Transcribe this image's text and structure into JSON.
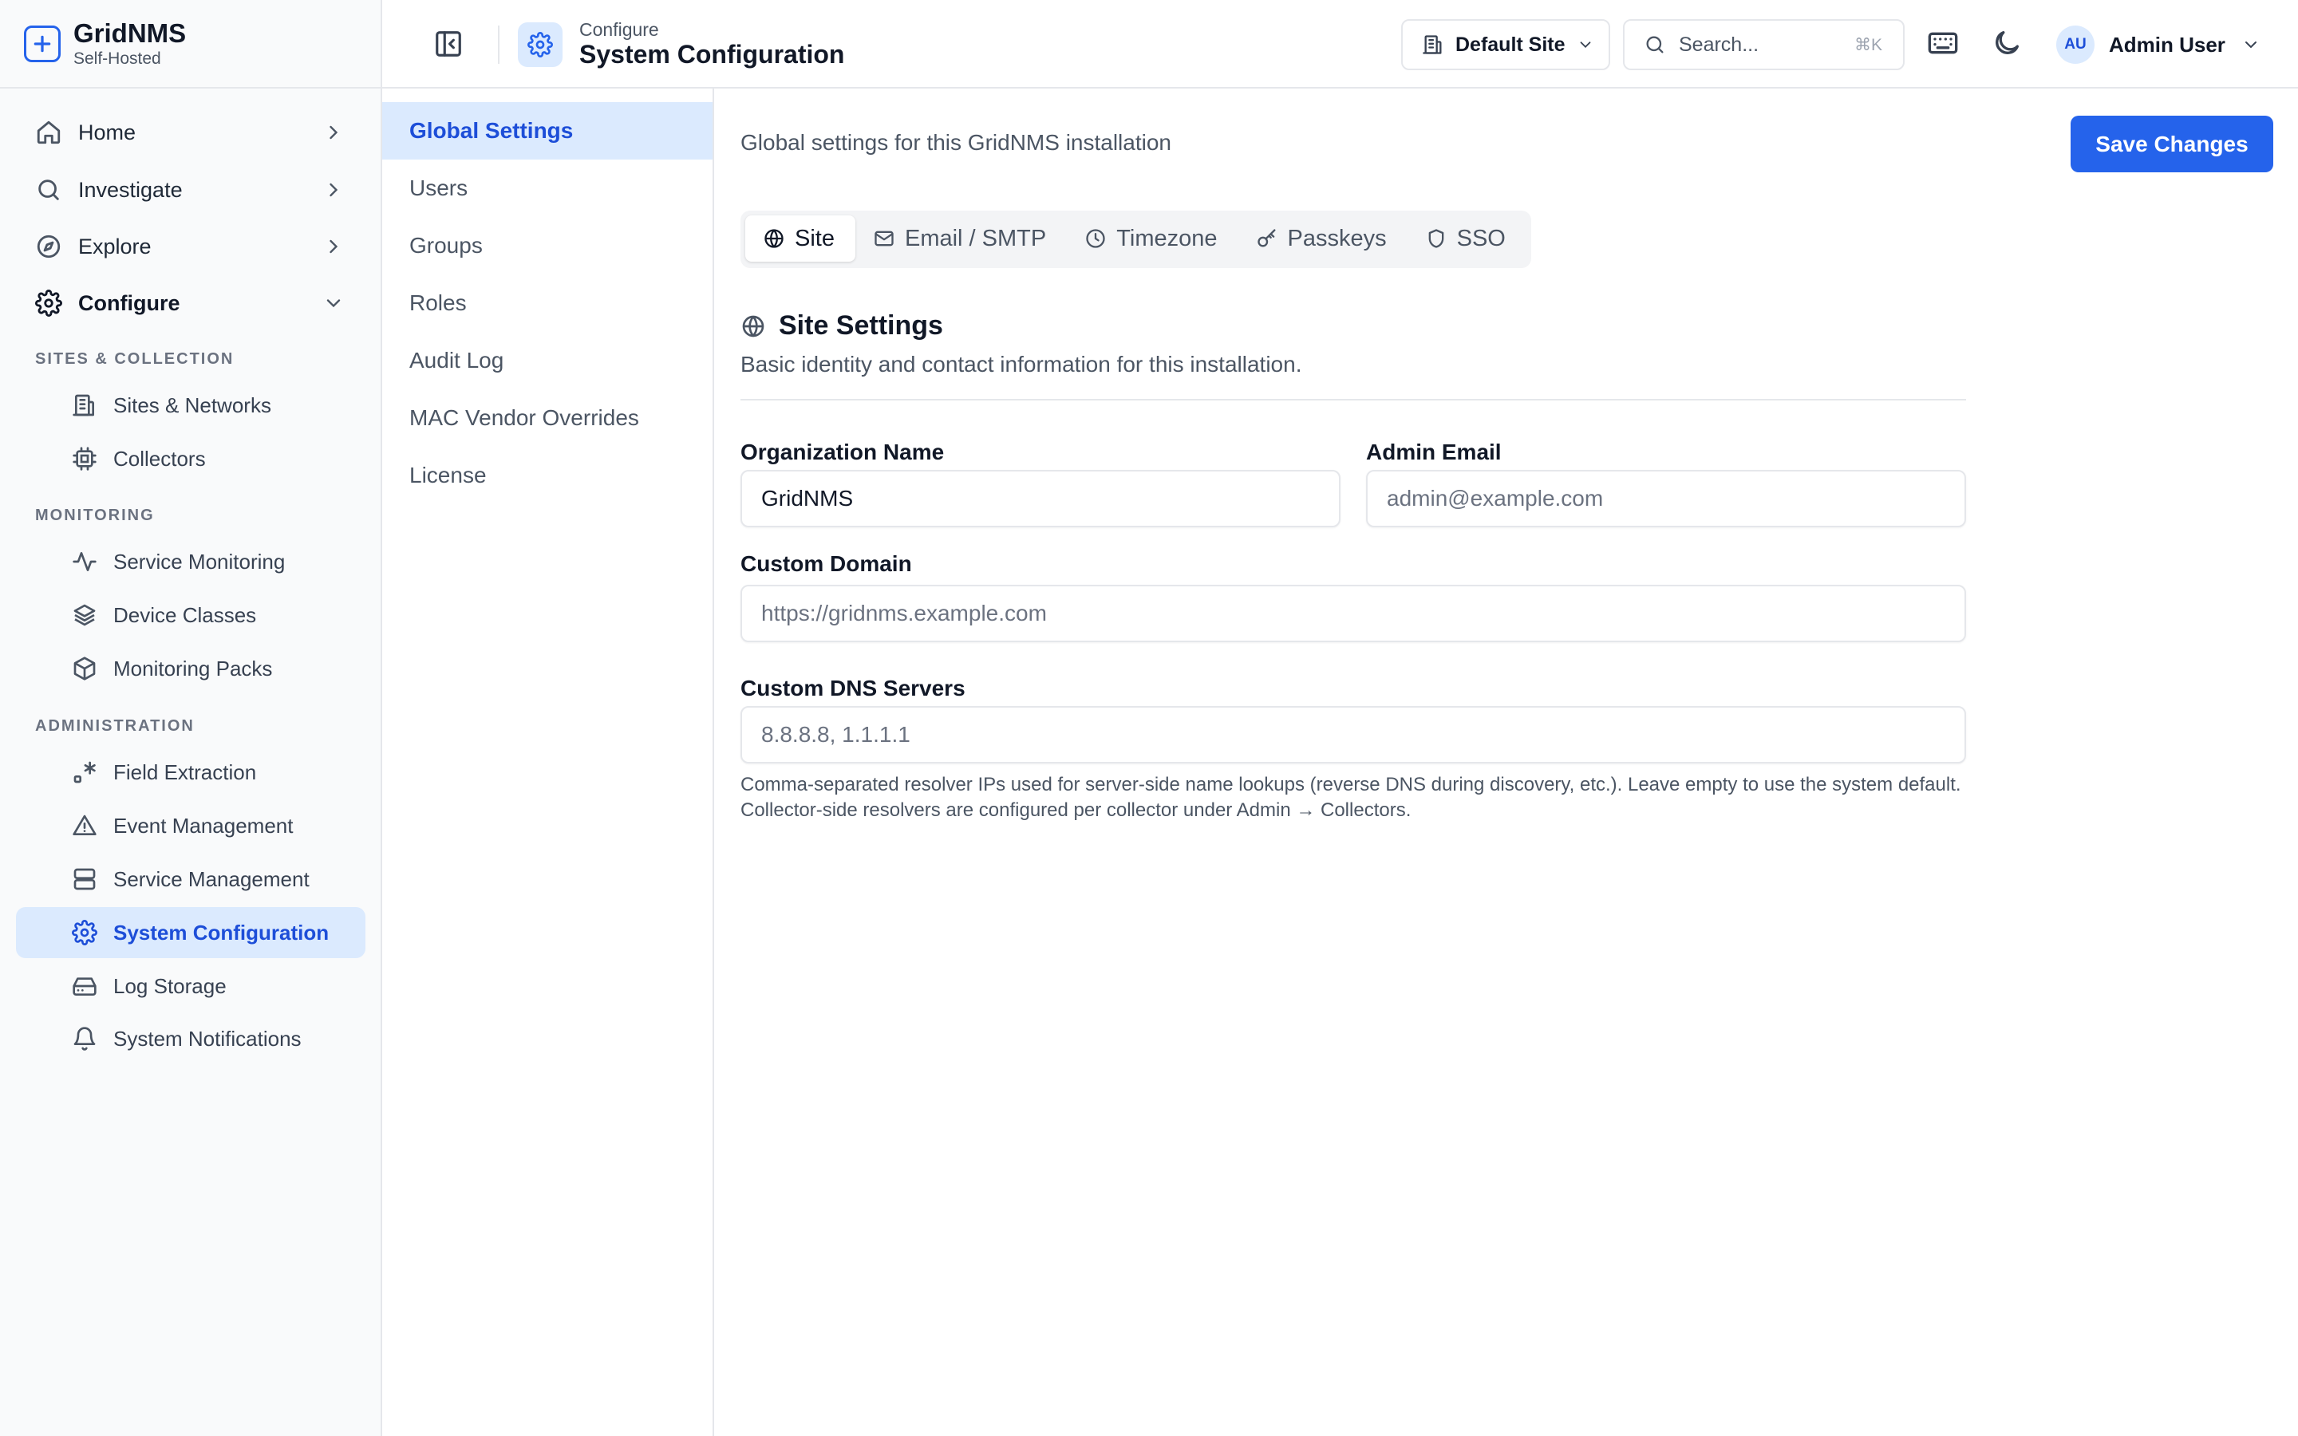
{
  "brand": {
    "name": "GridNMS",
    "subtitle": "Self-Hosted"
  },
  "sidebar": {
    "top_items": [
      {
        "label": "Home",
        "icon": "home-icon",
        "expanded": false
      },
      {
        "label": "Investigate",
        "icon": "search-icon",
        "expanded": false
      },
      {
        "label": "Explore",
        "icon": "compass-icon",
        "expanded": false
      },
      {
        "label": "Configure",
        "icon": "gear-icon",
        "expanded": true
      }
    ],
    "sections": [
      {
        "title": "SITES & COLLECTION",
        "items": [
          {
            "label": "Sites & Networks",
            "icon": "building-icon"
          },
          {
            "label": "Collectors",
            "icon": "cpu-icon"
          }
        ]
      },
      {
        "title": "MONITORING",
        "items": [
          {
            "label": "Service Monitoring",
            "icon": "activity-icon"
          },
          {
            "label": "Device Classes",
            "icon": "layers-icon"
          },
          {
            "label": "Monitoring Packs",
            "icon": "package-icon"
          }
        ]
      },
      {
        "title": "ADMINISTRATION",
        "items": [
          {
            "label": "Field Extraction",
            "icon": "regex-icon"
          },
          {
            "label": "Event Management",
            "icon": "warning-icon"
          },
          {
            "label": "Service Management",
            "icon": "server-icon"
          },
          {
            "label": "System Configuration",
            "icon": "gear-icon",
            "active": true
          },
          {
            "label": "Log Storage",
            "icon": "hard-drive-icon"
          },
          {
            "label": "System Notifications",
            "icon": "bell-icon"
          }
        ]
      }
    ]
  },
  "header": {
    "breadcrumb": "Configure",
    "title": "System Configuration",
    "site_selector": "Default Site",
    "search": {
      "placeholder": "Search...",
      "shortcut": "⌘K"
    },
    "user": {
      "initials": "AU",
      "name": "Admin User"
    }
  },
  "subnav": {
    "items": [
      "Global Settings",
      "Users",
      "Groups",
      "Roles",
      "Audit Log",
      "MAC Vendor Overrides",
      "License"
    ],
    "active": "Global Settings"
  },
  "main": {
    "description": "Global settings for this GridNMS installation",
    "save_label": "Save Changes",
    "tabs": [
      {
        "label": "Site",
        "icon": "globe-icon",
        "active": true
      },
      {
        "label": "Email / SMTP",
        "icon": "mail-icon"
      },
      {
        "label": "Timezone",
        "icon": "clock-icon"
      },
      {
        "label": "Passkeys",
        "icon": "key-icon"
      },
      {
        "label": "SSO",
        "icon": "shield-icon"
      }
    ],
    "section": {
      "title": "Site Settings",
      "description": "Basic identity and contact information for this installation."
    },
    "fields": {
      "org_name": {
        "label": "Organization Name",
        "value": "GridNMS",
        "placeholder": ""
      },
      "admin_email": {
        "label": "Admin Email",
        "value": "",
        "placeholder": "admin@example.com"
      },
      "custom_domain": {
        "label": "Custom Domain",
        "value": "",
        "placeholder": "https://gridnms.example.com"
      },
      "dns_servers": {
        "label": "Custom DNS Servers",
        "value": "",
        "placeholder": "8.8.8.8, 1.1.1.1",
        "help": "Comma-separated resolver IPs used for server-side name lookups (reverse DNS during discovery, etc.). Leave empty to use the system default. Collector-side resolvers are configured per collector under Admin → Collectors."
      }
    }
  },
  "colors": {
    "accent": "#2563eb",
    "active_bg": "#dbeafe",
    "active_text": "#1d4ed8"
  }
}
